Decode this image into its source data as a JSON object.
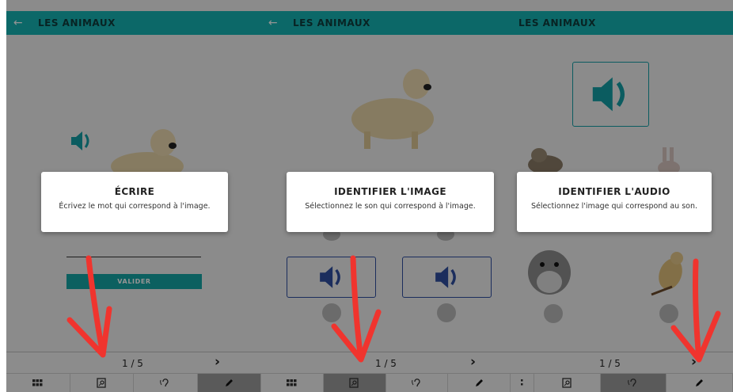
{
  "panels": [
    {
      "header_title": "LES ANIMAUX",
      "dialog": {
        "title": "ÉCRIRE",
        "text": "Écrivez le mot qui correspond à l'image."
      },
      "validate_label": "VALIDER",
      "pagination": "1 / 5"
    },
    {
      "header_title": "LES ANIMAUX",
      "dialog": {
        "title": "IDENTIFIER L'IMAGE",
        "text": "Sélectionnez le son qui correspond à l'image."
      },
      "pagination": "1 / 5"
    },
    {
      "header_title": "LES ANIMAUX",
      "dialog": {
        "title": "IDENTIFIER L'AUDIO",
        "text": "Sélectionnez l'image qui correspond au son."
      },
      "pagination": "1 / 5"
    }
  ],
  "colors": {
    "teal": "#15b3b4",
    "navy": "#2f4fa0",
    "annotation_red": "#f0342e"
  }
}
